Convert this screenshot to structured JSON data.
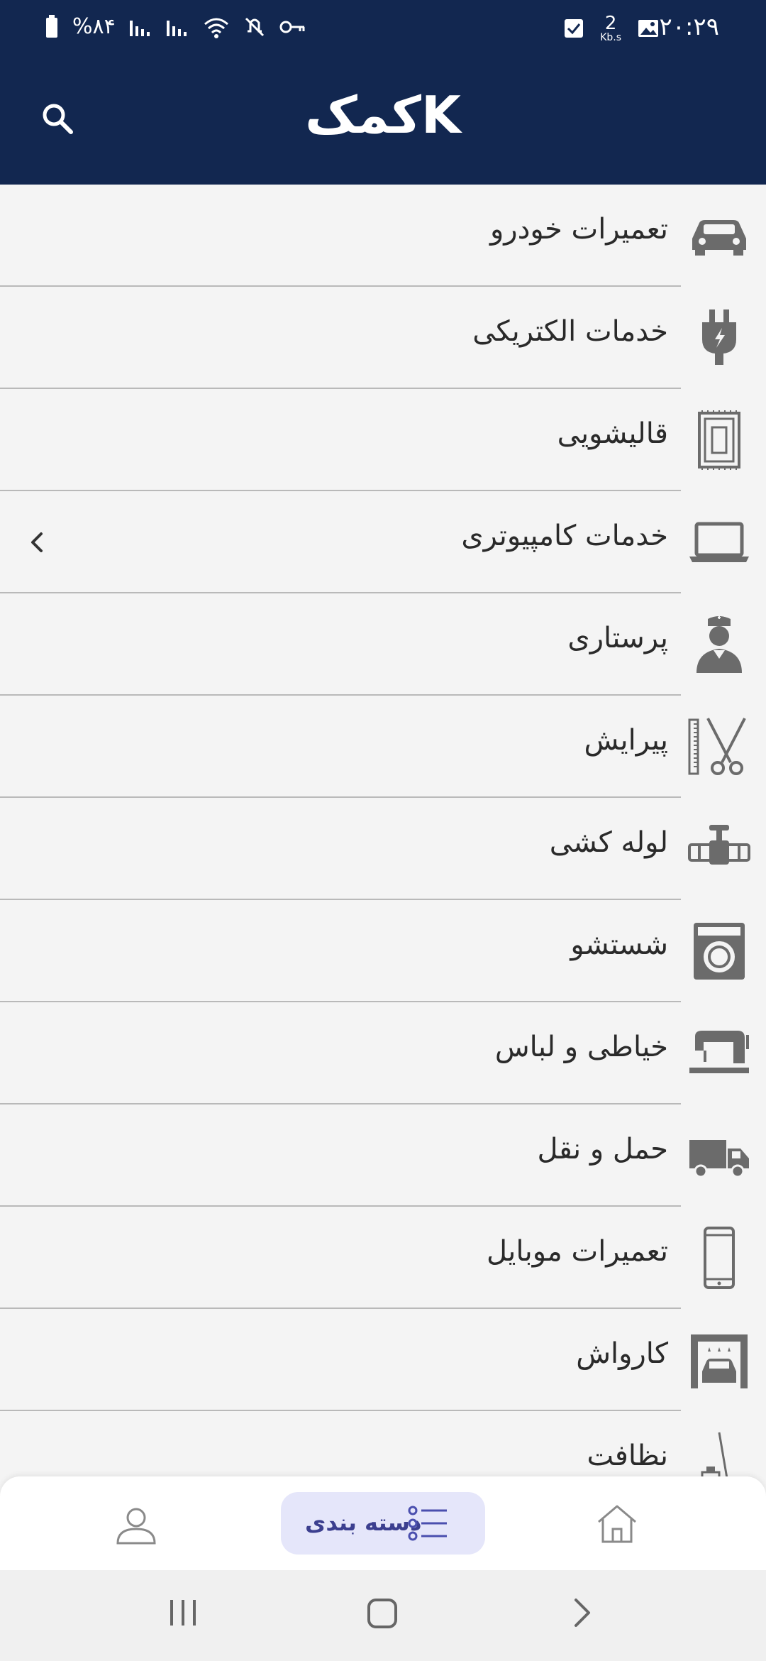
{
  "status_bar": {
    "time": "۲۰:۲۹",
    "battery": "%۸۴",
    "speed_value": "2",
    "speed_unit": "Kb.s"
  },
  "app_bar": {
    "title": "کمکK",
    "search_icon": "search-icon"
  },
  "categories": [
    {
      "label": "تعمیرات خودرو",
      "icon": "car-icon"
    },
    {
      "label": "خدمات الکتریکی",
      "icon": "plug-icon"
    },
    {
      "label": "قالیشویی",
      "icon": "carpet-icon"
    },
    {
      "label": "خدمات کامپیوتری",
      "icon": "laptop-icon",
      "expandable": true
    },
    {
      "label": "پرستاری",
      "icon": "nurse-icon"
    },
    {
      "label": "پیرایش",
      "icon": "scissors-comb-icon"
    },
    {
      "label": "لوله کشی",
      "icon": "pipe-valve-icon"
    },
    {
      "label": "شستشو",
      "icon": "washing-machine-icon"
    },
    {
      "label": "خیاطی و لباس",
      "icon": "sewing-machine-icon"
    },
    {
      "label": "حمل و نقل",
      "icon": "truck-icon"
    },
    {
      "label": "تعمیرات موبایل",
      "icon": "mobile-phone-icon"
    },
    {
      "label": "کارواش",
      "icon": "car-wash-icon"
    },
    {
      "label": "نظافت",
      "icon": "cleaning-icon"
    }
  ],
  "bottom_nav": {
    "profile_icon": "user-icon",
    "categories_label": "دسته بندی",
    "categories_icon": "list-icon",
    "home_icon": "home-icon",
    "active": "categories"
  },
  "colors": {
    "header_bg": "#122750",
    "list_bg": "#f4f4f4",
    "icon_gray": "#6b6b6b",
    "active_tab_bg": "#e5e6fa",
    "active_tab_text": "#3c3f8f"
  }
}
